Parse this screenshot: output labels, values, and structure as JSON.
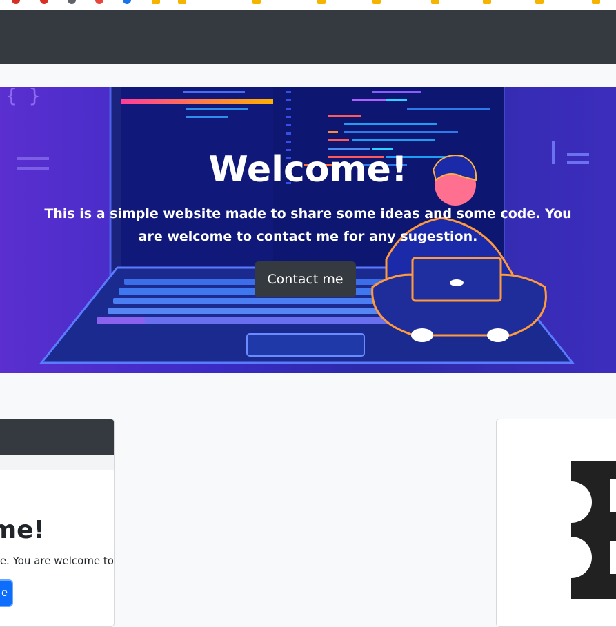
{
  "browser": {
    "bookmark_colors": [
      "#d93025",
      "#d93025",
      "#5f6368",
      "#e8453c",
      "#1a73e8",
      "#f4b400",
      "#f4b400",
      "#f4b400",
      "#f4b400",
      "#f4b400",
      "#f4b400",
      "#f4b400",
      "#f4b400",
      "#f4b400"
    ]
  },
  "hero": {
    "title": "Welcome!",
    "text": "This is a simple website made to share some ideas and some code. You are welcome to contact me for any sugestion.",
    "button_label": "Contact me"
  },
  "card_left": {
    "title": "me!",
    "text": "de. You are welcome to",
    "button_label": "e"
  },
  "colors": {
    "navbar": "#343a40",
    "primary": "#0d6efd",
    "background": "#f8f9fa"
  }
}
